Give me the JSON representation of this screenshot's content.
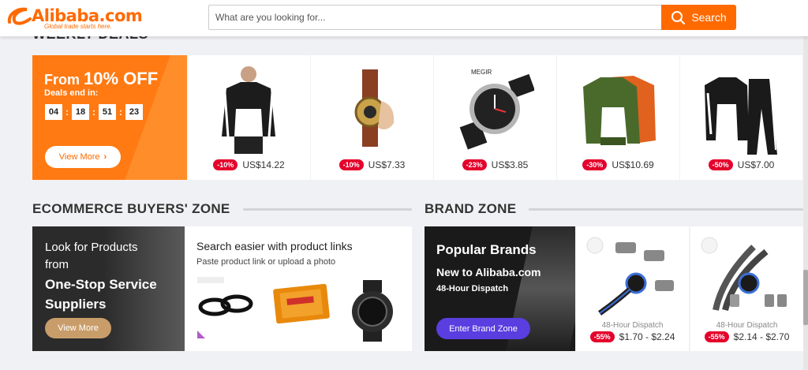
{
  "header": {
    "logo_name": "Alibaba.com",
    "logo_tagline": "Global trade starts here.",
    "search_placeholder": "What are you looking for...",
    "search_button": "Search"
  },
  "weekly_deals": {
    "title": "WEEKLY DEALS",
    "banner": {
      "from_label": "From",
      "discount": "10% OFF",
      "ends_label": "Deals end in:",
      "countdown": [
        "04",
        "18",
        "51",
        "23"
      ],
      "view_more": "View More"
    },
    "products": [
      {
        "discount": "-10%",
        "price": "US$14.22",
        "icon": "track-jacket-image"
      },
      {
        "discount": "-10%",
        "price": "US$7.33",
        "icon": "lighter-watch-image"
      },
      {
        "discount": "-23%",
        "price": "US$3.85",
        "icon": "wristwatch-image"
      },
      {
        "discount": "-30%",
        "price": "US$10.69",
        "icon": "bomber-jacket-image"
      },
      {
        "discount": "-50%",
        "price": "US$7.00",
        "icon": "tracksuit-image"
      }
    ]
  },
  "buyers_zone": {
    "title": "ECOMMERCE BUYERS' ZONE",
    "banner": {
      "line1": "Look for Products",
      "line2": "from",
      "line3": "One-Stop Service",
      "line4": "Suppliers",
      "button": "View More"
    },
    "search_links": {
      "heading": "Search easier with product links",
      "subtext": "Paste product link or upload a photo"
    }
  },
  "brand_zone": {
    "title": "BRAND ZONE",
    "banner": {
      "title": "Popular Brands",
      "subtitle": "New to Alibaba.com",
      "dispatch": "48-Hour Dispatch",
      "button": "Enter Brand Zone"
    },
    "products": [
      {
        "dispatch": "48-Hour Dispatch",
        "discount": "-55%",
        "price": "$1.70 - $2.24"
      },
      {
        "dispatch": "48-Hour Dispatch",
        "discount": "-55%",
        "price": "$2.14 - $2.70"
      }
    ]
  },
  "colors": {
    "brand_orange": "#ff6a00",
    "discount_red": "#e4002b",
    "brand_button_purple": "#5a3ee0",
    "buyers_button_gold": "#c99d6a"
  }
}
